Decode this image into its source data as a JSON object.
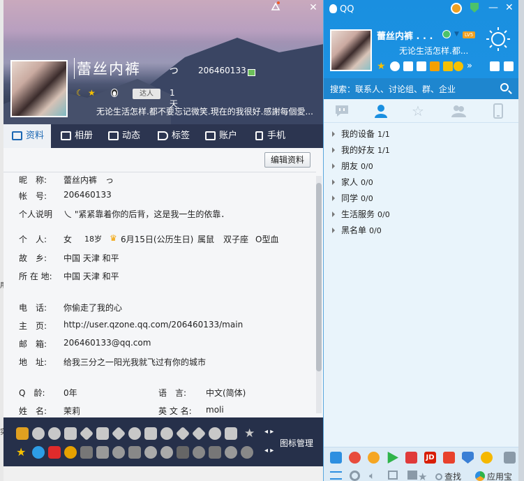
{
  "profile": {
    "nickname": "蕾丝内裤",
    "nickname_suffix": "っ",
    "qq_number": "206460133",
    "talent_badge": "达人",
    "days": "1天",
    "signature": "无论生活怎样.都不要忘记微笑.現在的我很好.感謝每個愛...",
    "tabs": [
      "资料",
      "相册",
      "动态",
      "标签",
      "账户",
      "手机"
    ],
    "edit_button": "编辑资料",
    "fields": {
      "nick_label": "昵　称:",
      "nick_value": "蕾丝内裤　っ",
      "account_label": "帐　号:",
      "account_value": "206460133",
      "bio_label": "个人说明",
      "bio_value": "乀 \"紧紧靠着你的后背，这是我一生的依靠．",
      "person_label": "个　人:",
      "gender": "女",
      "age": "18岁",
      "birthday": "6月15日(公历生日)",
      "zodiac": "属鼠",
      "constellation": "双子座",
      "blood": "O型血",
      "hometown_label": "故　乡:",
      "hometown_value": "中国 天津 和平",
      "location_label": "所 在 地:",
      "location_value": "中国 天津 和平",
      "phone_label": "电　话:",
      "phone_value": "你偷走了我的心",
      "homepage_label": "主　页:",
      "homepage_value": "http://user.qzone.qq.com/206460133/main",
      "email_label": "邮　箱:",
      "email_value": "206460133@qq.com",
      "address_label": "地　址:",
      "address_value": "给我三分之一阳光我就飞过有你的城市",
      "qage_label": "Q　龄:",
      "qage_value": "0年",
      "lang_label": "语　言:",
      "lang_value": "中文(简体)",
      "name_label": "姓　名:",
      "name_value": "茉莉",
      "ename_label": "英 文 名:",
      "ename_value": "moli"
    },
    "icon_manage": "图标管理"
  },
  "qq": {
    "title": "QQ",
    "nickname": "蕾丝内裤 . . .",
    "level": "LV5",
    "signature": "无论生活怎样.都...",
    "search_placeholder": "搜索：联系人、讨论组、群、企业",
    "groups": [
      {
        "name": "我的设备",
        "count": "1/1"
      },
      {
        "name": "我的好友",
        "count": "1/1"
      },
      {
        "name": "朋友",
        "count": "0/0"
      },
      {
        "name": "家人",
        "count": "0/0"
      },
      {
        "name": "同学",
        "count": "0/0"
      },
      {
        "name": "生活服务",
        "count": "0/0"
      },
      {
        "name": "黑名单",
        "count": "0/0"
      }
    ],
    "footer": {
      "find": "查找",
      "appstore": "应用宝"
    }
  },
  "edge_marks": [
    "用",
    "实"
  ],
  "colors": {
    "qq_blue": "#1a8fe0",
    "tab_bar": "#2c3550",
    "active_tab_text": "#1b67b3"
  }
}
